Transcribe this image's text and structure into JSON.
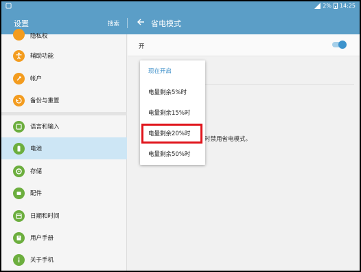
{
  "status_bar": {
    "battery": "2%",
    "time": "14:25"
  },
  "header": {
    "left_title": "设置",
    "search_label": "搜索",
    "right_title": "省电模式"
  },
  "sidebar": {
    "items": [
      {
        "label": "隐私权",
        "icon": "privacy-icon",
        "color": "#f39c1f"
      },
      {
        "label": "辅助功能",
        "icon": "accessibility-icon",
        "color": "#f39c1f"
      },
      {
        "label": "帐户",
        "icon": "account-icon",
        "color": "#f39c1f"
      },
      {
        "label": "备份与重置",
        "icon": "backup-icon",
        "color": "#f39c1f"
      },
      {
        "label": "语言和输入",
        "icon": "language-icon",
        "color": "#6cae3e"
      },
      {
        "label": "电池",
        "icon": "battery-icon",
        "color": "#6cae3e",
        "selected": true
      },
      {
        "label": "存储",
        "icon": "storage-icon",
        "color": "#6cae3e"
      },
      {
        "label": "配件",
        "icon": "accessory-icon",
        "color": "#6cae3e"
      },
      {
        "label": "日期和时间",
        "icon": "calendar-icon",
        "color": "#6cae3e"
      },
      {
        "label": "用户手册",
        "icon": "manual-icon",
        "color": "#6cae3e"
      },
      {
        "label": "关于手机",
        "icon": "info-icon",
        "color": "#6cae3e"
      }
    ]
  },
  "main": {
    "toggle_label": "开",
    "toggle_on": true,
    "description_fragment": "时禁用省电模式。"
  },
  "popup": {
    "options": [
      {
        "label": "现在开启",
        "current": true
      },
      {
        "label": "电量剩余5%时"
      },
      {
        "label": "电量剩余15%时"
      },
      {
        "label": "电量剩余20%时",
        "highlighted": true
      },
      {
        "label": "电量剩余50%时"
      }
    ]
  },
  "colors": {
    "accent": "#5b9ec7",
    "highlight": "#e0141b",
    "selected_row": "#cde6f5"
  }
}
